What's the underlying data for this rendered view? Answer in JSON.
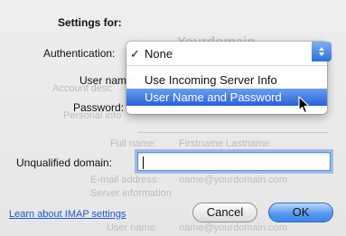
{
  "settings": {
    "title": "Settings for:",
    "auth_label": "Authentication:",
    "username_label": "User name:",
    "password_label": "Password:",
    "unqualified_label": "Unqualified domain:",
    "unqualified_value": ""
  },
  "auth_menu": {
    "checked_index": 0,
    "check_glyph": "✓",
    "items": [
      {
        "label": "None"
      },
      {
        "label": "Use Incoming Server Info"
      },
      {
        "label": "User Name and Password"
      }
    ],
    "highlighted_index": 2
  },
  "background_ghost": {
    "domain": "Yourdomain",
    "account_desc": "Account desc",
    "personal_info": "Personal info",
    "full_name_label": "Full name:",
    "full_name_value": "Firstname Lastname",
    "email_label": "E-mail address:",
    "email_value": "name@yourdomain.com",
    "server_info": "Server information",
    "server_user_label": "User name:",
    "server_user_value": "name@yourdomain.com"
  },
  "footer": {
    "help_link": "Learn about IMAP settings",
    "cancel": "Cancel",
    "ok": "OK"
  },
  "colors": {
    "accent": "#2f6fd6",
    "link": "#2156c9",
    "selection": "#2a62d8"
  }
}
